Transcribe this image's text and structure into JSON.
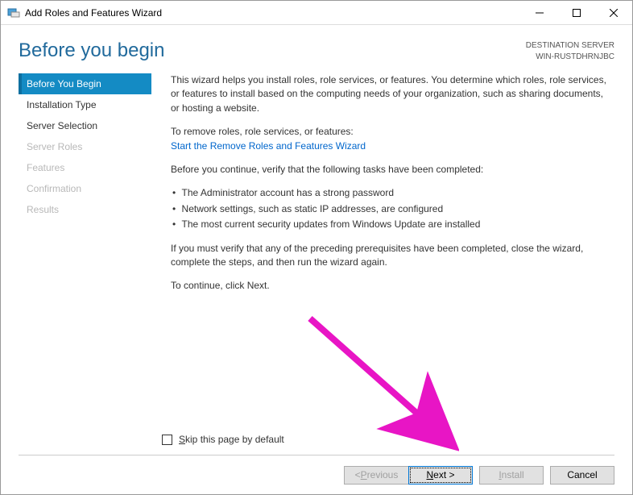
{
  "titlebar": {
    "title": "Add Roles and Features Wizard"
  },
  "header": {
    "heading": "Before you begin",
    "destLabel": "DESTINATION SERVER",
    "destServer": "WIN-RUSTDHRNJBC"
  },
  "sidebar": {
    "items": [
      {
        "label": "Before You Begin",
        "state": "active"
      },
      {
        "label": "Installation Type",
        "state": "normal"
      },
      {
        "label": "Server Selection",
        "state": "normal"
      },
      {
        "label": "Server Roles",
        "state": "disabled"
      },
      {
        "label": "Features",
        "state": "disabled"
      },
      {
        "label": "Confirmation",
        "state": "disabled"
      },
      {
        "label": "Results",
        "state": "disabled"
      }
    ]
  },
  "content": {
    "intro": "This wizard helps you install roles, role services, or features. You determine which roles, role services, or features to install based on the computing needs of your organization, such as sharing documents, or hosting a website.",
    "removeLead": "To remove roles, role services, or features:",
    "removeLink": "Start the Remove Roles and Features Wizard",
    "verifyLead": "Before you continue, verify that the following tasks have been completed:",
    "bullets": [
      "The Administrator account has a strong password",
      "Network settings, such as static IP addresses, are configured",
      "The most current security updates from Windows Update are installed"
    ],
    "mustVerify": "If you must verify that any of the preceding prerequisites have been completed, close the wizard, complete the steps, and then run the wizard again.",
    "continue": "To continue, click Next."
  },
  "skip": {
    "prefix": "S",
    "rest": "kip this page by default"
  },
  "footer": {
    "prev": {
      "lead": "< ",
      "u": "P",
      "rest": "revious"
    },
    "next": {
      "u": "N",
      "rest": "ext >"
    },
    "install": {
      "u": "I",
      "rest": "nstall"
    },
    "cancel": {
      "label": "Cancel"
    }
  }
}
